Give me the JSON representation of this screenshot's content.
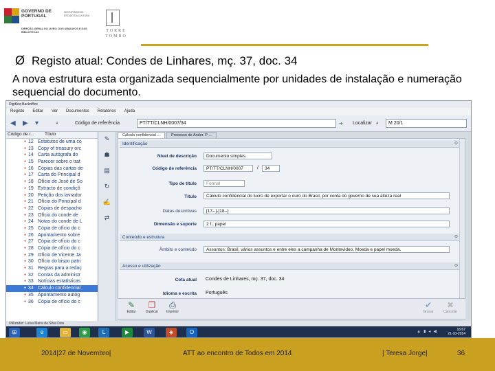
{
  "header": {
    "gov_logo_text": "GOVERNO DE PORTUGAL",
    "gov_logo_sub": "SECRETÁRIO DE ESTADO DA CULTURA",
    "gov_dept": "DIREÇÃO-GERAL DO LIVRO, DOS ARQUIVOS E DAS BIBLIOTECAS",
    "tt_logo_text": "TORRE TOMBO",
    "accent_color": "#c9a220"
  },
  "slide": {
    "bullet": "Ø",
    "title": "Registo atual: Condes de Linhares, mç. 37, doc. 34",
    "description": "A nova estrutura esta organizada sequencialmente por unidades de instalação e numeração sequencial do documento."
  },
  "app": {
    "title": "DigitArq Backoffice",
    "menu": [
      "Registo",
      "Editar",
      "Ver",
      "Documentos",
      "Relatórios",
      "Ajuda"
    ],
    "toolbar": {
      "ref_label": "Código de referência",
      "ref_value": "PT/TT/CLNH/0007/34",
      "search_label": "Localizar",
      "search_value": "M 20/1"
    },
    "tree": {
      "col_code": "Código de r...",
      "col_title": "Título",
      "rows": [
        {
          "num": "12",
          "title": "Estatutos de uma co"
        },
        {
          "num": "13",
          "title": "Copy of treasury orc"
        },
        {
          "num": "14",
          "title": "Carta autógrafa do"
        },
        {
          "num": "15",
          "title": "Parecer sobre o trat"
        },
        {
          "num": "16",
          "title": "Cópias das cartas de"
        },
        {
          "num": "17",
          "title": "Carta do Principal d"
        },
        {
          "num": "18",
          "title": "Ofício de José de So"
        },
        {
          "num": "19",
          "title": "Extracto de condiçõ"
        },
        {
          "num": "20",
          "title": "Petição dos lavrador"
        },
        {
          "num": "21",
          "title": "Ofício do Principal d"
        },
        {
          "num": "22",
          "title": "Cópias de despacho"
        },
        {
          "num": "23",
          "title": "Ofício do conde de"
        },
        {
          "num": "24",
          "title": "Notas do conde de L"
        },
        {
          "num": "25",
          "title": "Cópia de ofício do c"
        },
        {
          "num": "26",
          "title": "Apontamento sobre"
        },
        {
          "num": "27",
          "title": "Cópia de ofício do c"
        },
        {
          "num": "28",
          "title": "Cópia de ofício do c"
        },
        {
          "num": "29",
          "title": "Ofício de Vicente Ja"
        },
        {
          "num": "30",
          "title": "Ofício do bispo patri"
        },
        {
          "num": "31",
          "title": "Regras para a redaç"
        },
        {
          "num": "32",
          "title": "Contas da administr"
        },
        {
          "num": "33",
          "title": "Notícias estatísticas"
        },
        {
          "num": "34",
          "title": "Cálculo confidencial",
          "selected": true
        },
        {
          "num": "35",
          "title": "Apontamento autóg"
        },
        {
          "num": "36",
          "title": "Cópia de ofício do c"
        }
      ]
    },
    "tabs": [
      "Cálculo confidencial ...",
      "Processo de Ander. P ..."
    ],
    "form": {
      "sec_identificacao": "Identificação",
      "nivel_label": "Nível de descrição",
      "nivel_value": "Documento simples",
      "codigo_label": "Código de referência",
      "codigo_value": "PT/TT/CLNH/0007",
      "codigo_suffix": "34",
      "tipo_label": "Tipo de título",
      "tipo_value": "Formal",
      "titulo_label": "Título",
      "titulo_value": "Cálculo confidencial do lucro de exportar o ouro do Brasil, por conta do governo de sua alteza real",
      "datas_label": "Datas descritivas",
      "datas_value": "[17--]-[18--]",
      "dimensao_label": "Dimensão e suporte",
      "dimensao_value": "2 f.; papel",
      "sec_conteudo": "Conteúdo e estrutura",
      "ambito_label": "Âmbito e conteúdo",
      "ambito_value": "Assuntos: Brasil, vários assuntos e entre eles a campanha de Montevideo, Moeda e papel moeda.",
      "sec_acesso": "Acesso e utilização",
      "cota_label": "Cota atual",
      "cota_value": "Condes de Linhares, mç. 37, doc. 34",
      "idioma_label": "Idioma e escrita",
      "idioma_value": "Português"
    },
    "buttons": {
      "editar": "Editar",
      "duplicar": "Duplicar",
      "imprimir": "Imprimir",
      "gravar": "Gravar",
      "cancelar": "Cancelar"
    },
    "status": "Utilizador: Luísa Maria da Silva Dias",
    "clock_time": "16:67",
    "clock_date": "21-10-2014"
  },
  "footer": {
    "date": "2014|27 de Novembro|",
    "event": "ATT ao encontro de Todos em 2014",
    "author": "| Teresa Jorge|",
    "page": "36"
  }
}
